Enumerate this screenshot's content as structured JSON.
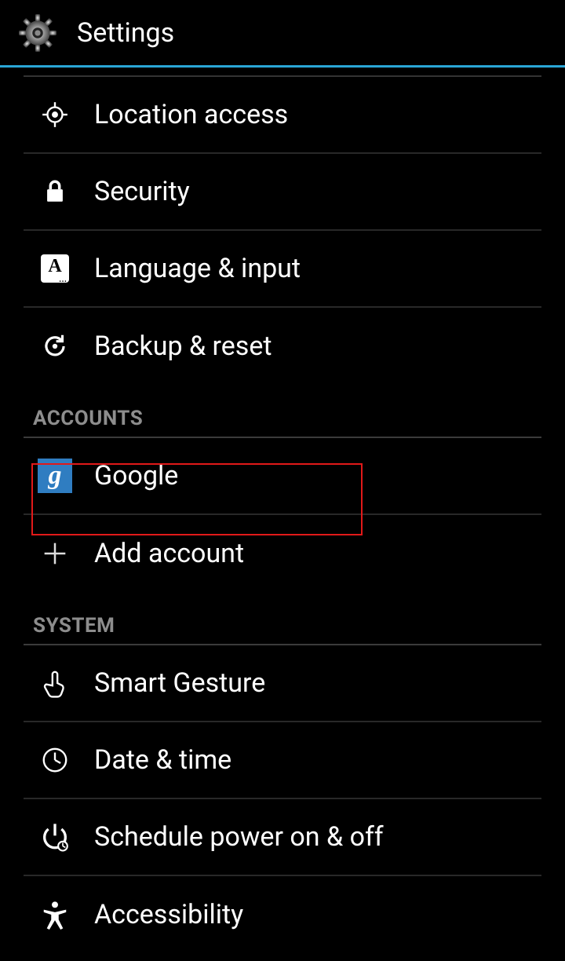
{
  "header": {
    "title": "Settings"
  },
  "items1": [
    {
      "label": "Location access",
      "icon": "location-icon"
    },
    {
      "label": "Security",
      "icon": "lock-icon"
    },
    {
      "label": "Language & input",
      "icon": "language-icon"
    },
    {
      "label": "Backup & reset",
      "icon": "backup-icon"
    }
  ],
  "section_accounts": "ACCOUNTS",
  "items_accounts": [
    {
      "label": "Google",
      "icon": "google-icon"
    },
    {
      "label": "Add account",
      "icon": "plus-icon"
    }
  ],
  "section_system": "SYSTEM",
  "items_system": [
    {
      "label": "Smart Gesture",
      "icon": "gesture-icon"
    },
    {
      "label": "Date & time",
      "icon": "clock-icon"
    },
    {
      "label": "Schedule power on & off",
      "icon": "schedule-power-icon"
    },
    {
      "label": "Accessibility",
      "icon": "accessibility-icon"
    }
  ],
  "highlight": {
    "target": "google-item"
  },
  "colors": {
    "accent": "#2aa6d6",
    "highlight": "#e11919",
    "google": "#2f7dc1"
  }
}
